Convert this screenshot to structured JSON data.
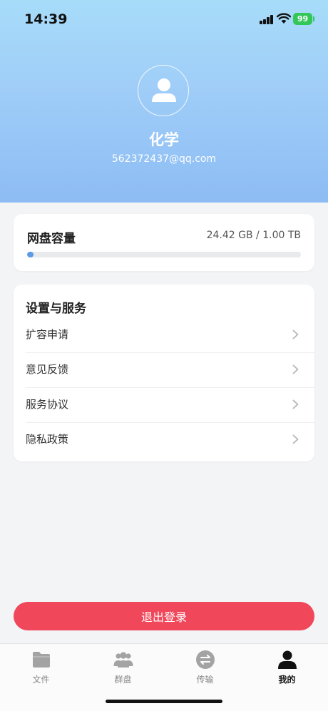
{
  "status_bar": {
    "time": "14:39",
    "battery": "99"
  },
  "profile": {
    "name": "化学",
    "email": "562372437@qq.com"
  },
  "storage": {
    "title": "网盘容量",
    "usage_text": "24.42 GB / 1.00 TB",
    "used_fraction": 0.024
  },
  "settings": {
    "title": "设置与服务",
    "items": [
      {
        "label": "扩容申请"
      },
      {
        "label": "意见反馈"
      },
      {
        "label": "服务协议"
      },
      {
        "label": "隐私政策"
      }
    ]
  },
  "logout": {
    "label": "退出登录"
  },
  "tabs": [
    {
      "label": "文件",
      "icon": "folder-icon",
      "active": false
    },
    {
      "label": "群盘",
      "icon": "group-icon",
      "active": false
    },
    {
      "label": "传输",
      "icon": "transfer-icon",
      "active": false
    },
    {
      "label": "我的",
      "icon": "user-icon",
      "active": true
    }
  ],
  "colors": {
    "accent": "#5d9be8",
    "danger": "#f0475a",
    "header_top": "#a7dcf9",
    "header_bottom": "#8dbcf4"
  }
}
